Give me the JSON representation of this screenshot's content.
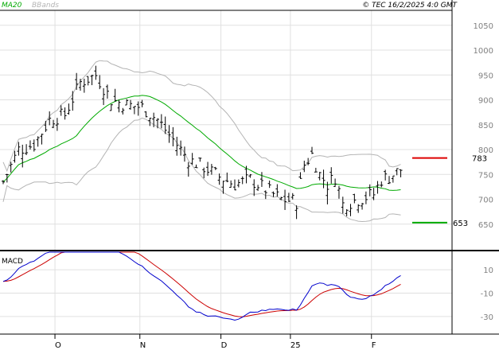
{
  "header": {
    "ma_label": "MA20",
    "bb_label": "BBands",
    "copyright": "© TEC 16/2/2025 4:0 GMT"
  },
  "macd_label": "MACD",
  "colors": {
    "price_bar": "#000000",
    "ma": "#00aa00",
    "bbands": "#b4b4b4",
    "resistance": "#dd0000",
    "support": "#00aa00",
    "macd": "#0000cc",
    "signal": "#cc0000",
    "grid": "#e0e0e0",
    "axis_text": "#808080"
  },
  "chart_data": [
    {
      "type": "ohlc",
      "name": "price",
      "ylim": [
        600,
        1080
      ],
      "y_ticks": [
        "1050",
        "1000",
        "950",
        "900",
        "850",
        "800",
        "750",
        "700",
        "650"
      ],
      "x_tick_labels": [
        "O",
        "N",
        "D",
        "25",
        "F"
      ],
      "levels": [
        {
          "label": "783",
          "value": 783,
          "color": "#dd0000"
        },
        {
          "label": "653",
          "value": 653,
          "color": "#00aa00"
        }
      ],
      "series": [
        {
          "name": "MA20",
          "color": "#00aa00"
        },
        {
          "name": "BBands",
          "color": "#b4b4b4"
        }
      ]
    },
    {
      "type": "line",
      "name": "MACD",
      "ylim": [
        -45,
        25
      ],
      "y_ticks": [
        "10",
        "-10",
        "-30"
      ],
      "series": [
        {
          "name": "MACD",
          "color": "#0000cc"
        },
        {
          "name": "Signal",
          "color": "#cc0000"
        }
      ]
    }
  ]
}
